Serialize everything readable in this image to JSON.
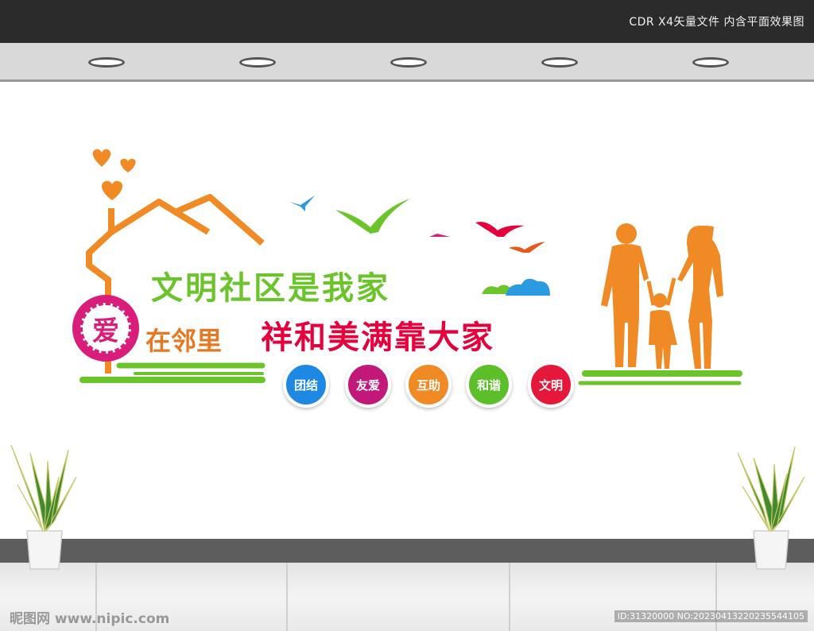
{
  "header": {
    "caption": "CDR X4矢量文件  内含平面效果图"
  },
  "signage": {
    "title_main": "文明社区是我家",
    "title_sub": "祥和美满靠大家",
    "badge_char": "爱",
    "badge_text": "在邻里",
    "values": [
      {
        "label": "团结",
        "color": "#1e88e5"
      },
      {
        "label": "友爱",
        "color": "#c2187a"
      },
      {
        "label": "互助",
        "color": "#f08a24"
      },
      {
        "label": "和谐",
        "color": "#5cbf2a"
      },
      {
        "label": "文明",
        "color": "#e5173a"
      }
    ]
  },
  "footer": {
    "watermark": "昵图网 www.nipic.com",
    "id_text": "ID:31320000 NO:20230413220235544105"
  },
  "colors": {
    "green": "#6cc42b",
    "red": "#e6003c",
    "orange": "#f08a24",
    "magenta": "#d81e7a",
    "blue": "#2a9be0"
  }
}
